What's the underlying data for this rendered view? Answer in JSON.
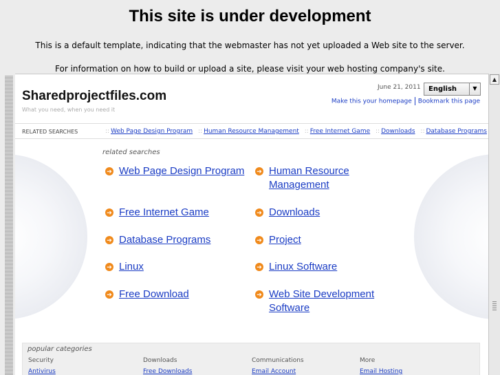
{
  "notice": {
    "title": "This site is under development",
    "line1": "This is a default template, indicating that the webmaster has not yet uploaded a Web site to the server.",
    "line2": "For information on how to build or upload a site, please visit your web hosting company's site."
  },
  "header": {
    "site_name": "Sharedprojectfiles.com",
    "tagline": "What you need, when you need it",
    "date": "June 21, 2011",
    "language": "English",
    "homepage_link": "Make this your homepage",
    "bookmark_link": "Bookmark this page"
  },
  "related_bar": {
    "label": "RELATED SEARCHES",
    "links": [
      "Web Page Design Program",
      "Human Resource Management",
      "Free Internet Game",
      "Downloads",
      "Database Programs"
    ]
  },
  "related": {
    "title": "related searches",
    "items": [
      "Web Page Design Program",
      "Human Resource Management",
      "Free Internet Game",
      "Downloads",
      "Database Programs",
      "Project",
      "Linux",
      "Linux Software",
      "Free Download",
      "Web Site Development Software"
    ]
  },
  "popular": {
    "title": "popular categories",
    "columns": [
      {
        "head": "Security",
        "link": "Antivirus"
      },
      {
        "head": "Downloads",
        "link": "Free Downloads"
      },
      {
        "head": "Communications",
        "link": "Email Account"
      },
      {
        "head": "More",
        "link": "Email Hosting"
      }
    ]
  },
  "colors": {
    "link": "#1a3cc4",
    "arrow": "#f08a1c",
    "background": "#ececec"
  }
}
